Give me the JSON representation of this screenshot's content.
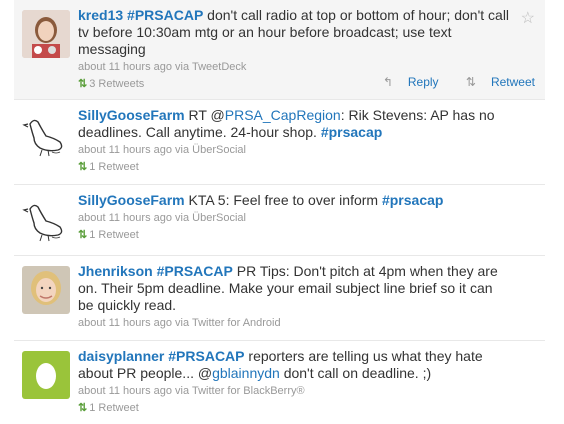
{
  "tweets": [
    {
      "user": "kred13",
      "tag": "#PRSACAP",
      "text": " don't call radio at top or bottom of hour; don't call tv before 10:30am mtg or an hour before broadcast; use text messaging",
      "time": "about 11 hours ago",
      "via": "via TweetDeck",
      "retweets": "3 Retweets",
      "reply_label": "Reply",
      "retweet_label": "Retweet",
      "star_icon": "star-icon"
    },
    {
      "user": "SillyGooseFarm",
      "pre": " RT @",
      "mention": "PRSA_CapRegion",
      "text": ": Rik Stevens: AP has no deadlines. Call anytime. 24-hour shop. ",
      "tag": "#prsacap",
      "time": "about 11 hours ago",
      "via": "via ÜberSocial",
      "retweets": "1 Retweet"
    },
    {
      "user": "SillyGooseFarm",
      "text": " KTA 5: Feel free to over inform ",
      "tag": "#prsacap",
      "time": "about 11 hours ago",
      "via": "via ÜberSocial",
      "retweets": "1 Retweet"
    },
    {
      "user": "Jhenrikson",
      "tag": "#PRSACAP",
      "text": " PR Tips: Don't pitch at 4pm when they are on. Their 5pm deadline. Make your email subject line brief so it can be quickly read.",
      "time": "about 11 hours ago",
      "via": "via Twitter for Android"
    },
    {
      "user": "daisyplanner",
      "tag": "#PRSACAP",
      "text": " reporters are telling us what they hate about PR people... @",
      "mention": "gblainnydn",
      "text2": " don't call on deadline. ;)",
      "time": "about 11 hours ago",
      "via": "via Twitter for BlackBerry®",
      "retweets": "1 Retweet"
    }
  ]
}
